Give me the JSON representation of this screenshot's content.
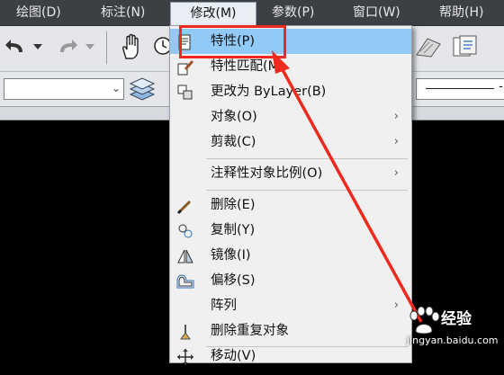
{
  "menubar": {
    "items": [
      {
        "label": "绘图(D)"
      },
      {
        "label": "标注(N)"
      },
      {
        "label": "修改(M)"
      },
      {
        "label": "参数(P)"
      },
      {
        "label": "窗口(W)"
      },
      {
        "label": "帮助(H)"
      }
    ],
    "active_index": 2
  },
  "toolbar": {
    "icons": [
      "undo-icon",
      "dropdown-arrow-icon",
      "redo-icon",
      "dropdown-arrow-icon",
      "pan-hand-icon",
      "zoom-realtime-icon",
      "render-icon",
      "sheet-set-icon"
    ]
  },
  "toolbar2": {
    "right_text": "-"
  },
  "dropdown": {
    "items": [
      {
        "label": "特性(P)",
        "icon": "properties-icon",
        "highlighted": true
      },
      {
        "label": "特性匹配(M)",
        "icon": "match-properties-icon"
      },
      {
        "label": "更改为 ByLayer(B)",
        "icon": "change-to-bylayer-icon"
      },
      {
        "label": "对象(O)",
        "submenu": true
      },
      {
        "label": "剪裁(C)",
        "submenu": true
      },
      {
        "label": "注释性对象比例(O)",
        "submenu": true
      },
      {
        "label": "删除(E)",
        "icon": "erase-icon"
      },
      {
        "label": "复制(Y)",
        "icon": "copy-icon"
      },
      {
        "label": "镜像(I)",
        "icon": "mirror-icon"
      },
      {
        "label": "偏移(S)",
        "icon": "offset-icon"
      },
      {
        "label": "阵列",
        "submenu": true
      },
      {
        "label": "删除重复对象",
        "icon": "delete-duplicates-icon"
      },
      {
        "label": "移动(V)",
        "icon": "move-icon"
      }
    ],
    "submenu_glyph": "›"
  },
  "annotation": {
    "box_color": "#ee2a1e",
    "arrow_color": "#ee2a1e"
  },
  "watermark": {
    "brand": "Baidu",
    "text": "经验",
    "url": "jingyan.baidu.com"
  },
  "colors": {
    "menubar_bg": "#3c3f44",
    "toolbar_bg": "#e4e6ea",
    "highlight": "#91c9f7",
    "canvas_bg": "#000000"
  }
}
